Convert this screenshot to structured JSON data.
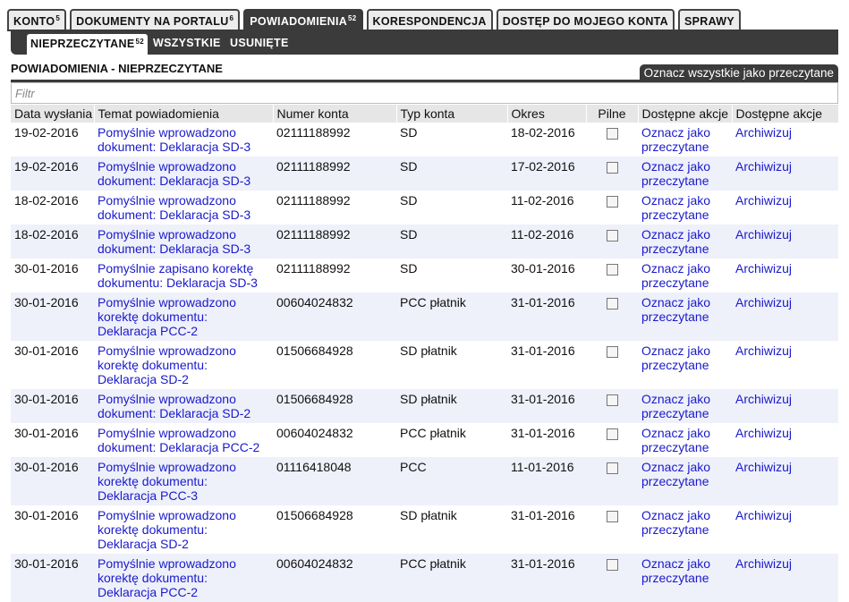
{
  "tabs": [
    {
      "label": "KONTO",
      "badge": "5",
      "active": false
    },
    {
      "label": "DOKUMENTY NA PORTALU",
      "badge": "6",
      "active": false
    },
    {
      "label": "POWIADOMIENIA",
      "badge": "52",
      "active": true
    },
    {
      "label": "KORESPONDENCJA",
      "badge": "",
      "active": false
    },
    {
      "label": "DOSTĘP DO MOJEGO KONTA",
      "badge": "",
      "active": false
    },
    {
      "label": "SPRAWY",
      "badge": "",
      "active": false
    }
  ],
  "subtabs": [
    {
      "label": "NIEPRZECZYTANE",
      "badge": "52",
      "active": true
    },
    {
      "label": "WSZYSTKIE",
      "badge": "",
      "active": false
    },
    {
      "label": "USUNIĘTE",
      "badge": "",
      "active": false
    }
  ],
  "page_title": "POWIADOMIENIA - NIEPRZECZYTANE",
  "mark_all_label": "Oznacz wszystkie jako przeczytane",
  "filter": {
    "placeholder": "Filtr",
    "value": ""
  },
  "columns": [
    "Data wysłania",
    "Temat powiadomienia",
    "Numer konta",
    "Typ konta",
    "Okres",
    "Pilne",
    "Dostępne akcje",
    "Dostępne akcje"
  ],
  "rows": [
    {
      "date": "19-02-2016",
      "subject": "Pomyślnie wprowadzono dokument: Deklaracja SD-3",
      "account": "02111188992",
      "type": "SD",
      "period": "18-02-2016",
      "urgent": false,
      "action1": "Oznacz jako przeczytane",
      "action2": "Archiwizuj"
    },
    {
      "date": "19-02-2016",
      "subject": "Pomyślnie wprowadzono dokument: Deklaracja SD-3",
      "account": "02111188992",
      "type": "SD",
      "period": "17-02-2016",
      "urgent": false,
      "action1": "Oznacz jako przeczytane",
      "action2": "Archiwizuj"
    },
    {
      "date": "18-02-2016",
      "subject": "Pomyślnie wprowadzono dokument: Deklaracja SD-3",
      "account": "02111188992",
      "type": "SD",
      "period": "11-02-2016",
      "urgent": false,
      "action1": "Oznacz jako przeczytane",
      "action2": "Archiwizuj"
    },
    {
      "date": "18-02-2016",
      "subject": "Pomyślnie wprowadzono dokument: Deklaracja SD-3",
      "account": "02111188992",
      "type": "SD",
      "period": "11-02-2016",
      "urgent": false,
      "action1": "Oznacz jako przeczytane",
      "action2": "Archiwizuj"
    },
    {
      "date": "30-01-2016",
      "subject": "Pomyślnie zapisano korektę dokumentu: Deklaracja SD-3",
      "account": "02111188992",
      "type": "SD",
      "period": "30-01-2016",
      "urgent": false,
      "action1": "Oznacz jako przeczytane",
      "action2": "Archiwizuj"
    },
    {
      "date": "30-01-2016",
      "subject": "Pomyślnie wprowadzono korektę dokumentu: Deklaracja PCC-2",
      "account": "00604024832",
      "type": "PCC płatnik",
      "period": "31-01-2016",
      "urgent": false,
      "action1": "Oznacz jako przeczytane",
      "action2": "Archiwizuj"
    },
    {
      "date": "30-01-2016",
      "subject": "Pomyślnie wprowadzono korektę dokumentu: Deklaracja SD-2",
      "account": "01506684928",
      "type": "SD płatnik",
      "period": "31-01-2016",
      "urgent": false,
      "action1": "Oznacz jako przeczytane",
      "action2": "Archiwizuj"
    },
    {
      "date": "30-01-2016",
      "subject": "Pomyślnie wprowadzono dokument: Deklaracja SD-2",
      "account": "01506684928",
      "type": "SD płatnik",
      "period": "31-01-2016",
      "urgent": false,
      "action1": "Oznacz jako przeczytane",
      "action2": "Archiwizuj"
    },
    {
      "date": "30-01-2016",
      "subject": "Pomyślnie wprowadzono dokument: Deklaracja PCC-2",
      "account": "00604024832",
      "type": "PCC płatnik",
      "period": "31-01-2016",
      "urgent": false,
      "action1": "Oznacz jako przeczytane",
      "action2": "Archiwizuj"
    },
    {
      "date": "30-01-2016",
      "subject": "Pomyślnie wprowadzono korektę dokumentu: Deklaracja PCC-3",
      "account": "01116418048",
      "type": "PCC",
      "period": "11-01-2016",
      "urgent": false,
      "action1": "Oznacz jako przeczytane",
      "action2": "Archiwizuj"
    },
    {
      "date": "30-01-2016",
      "subject": "Pomyślnie wprowadzono korektę dokumentu: Deklaracja SD-2",
      "account": "01506684928",
      "type": "SD płatnik",
      "period": "31-01-2016",
      "urgent": false,
      "action1": "Oznacz jako przeczytane",
      "action2": "Archiwizuj"
    },
    {
      "date": "30-01-2016",
      "subject": "Pomyślnie wprowadzono korektę dokumentu: Deklaracja PCC-2",
      "account": "00604024832",
      "type": "PCC płatnik",
      "period": "31-01-2016",
      "urgent": false,
      "action1": "Oznacz jako przeczytane",
      "action2": "Archiwizuj"
    }
  ]
}
